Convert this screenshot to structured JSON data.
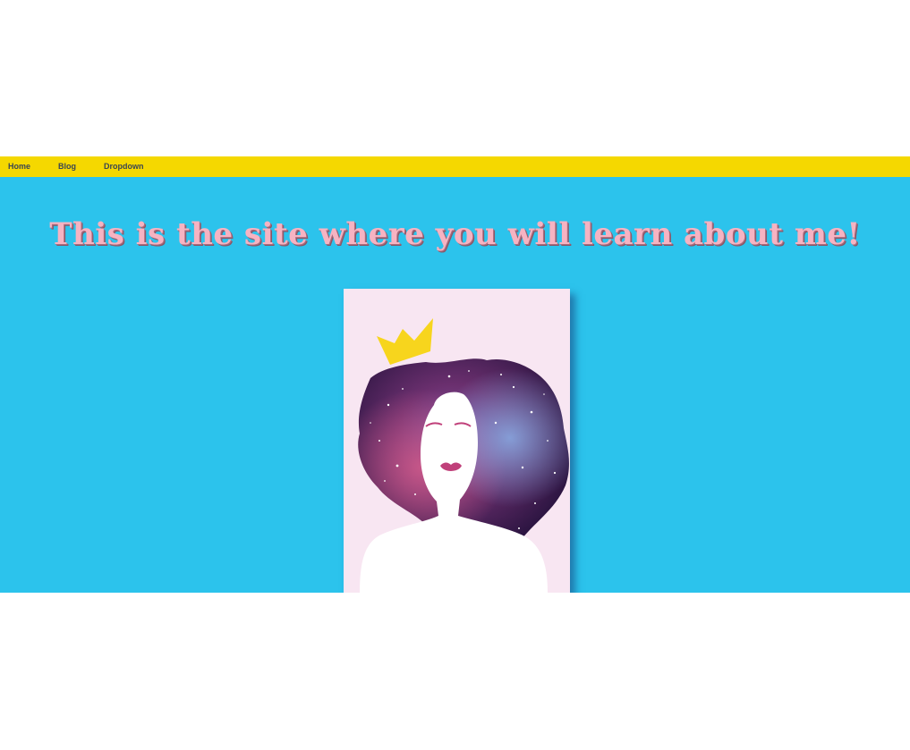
{
  "nav": {
    "items": [
      {
        "label": "Home"
      },
      {
        "label": "Blog"
      },
      {
        "label": "Dropdown"
      }
    ]
  },
  "hero": {
    "headline": "This is the site where you will learn about me!"
  },
  "colors": {
    "navbar_bg": "#f5d800",
    "hero_bg": "#2cc3ec",
    "headline": "#f6b3c2",
    "portrait_bg": "#f8e6f2",
    "crown": "#f7d51d",
    "lips": "#c0407a"
  }
}
